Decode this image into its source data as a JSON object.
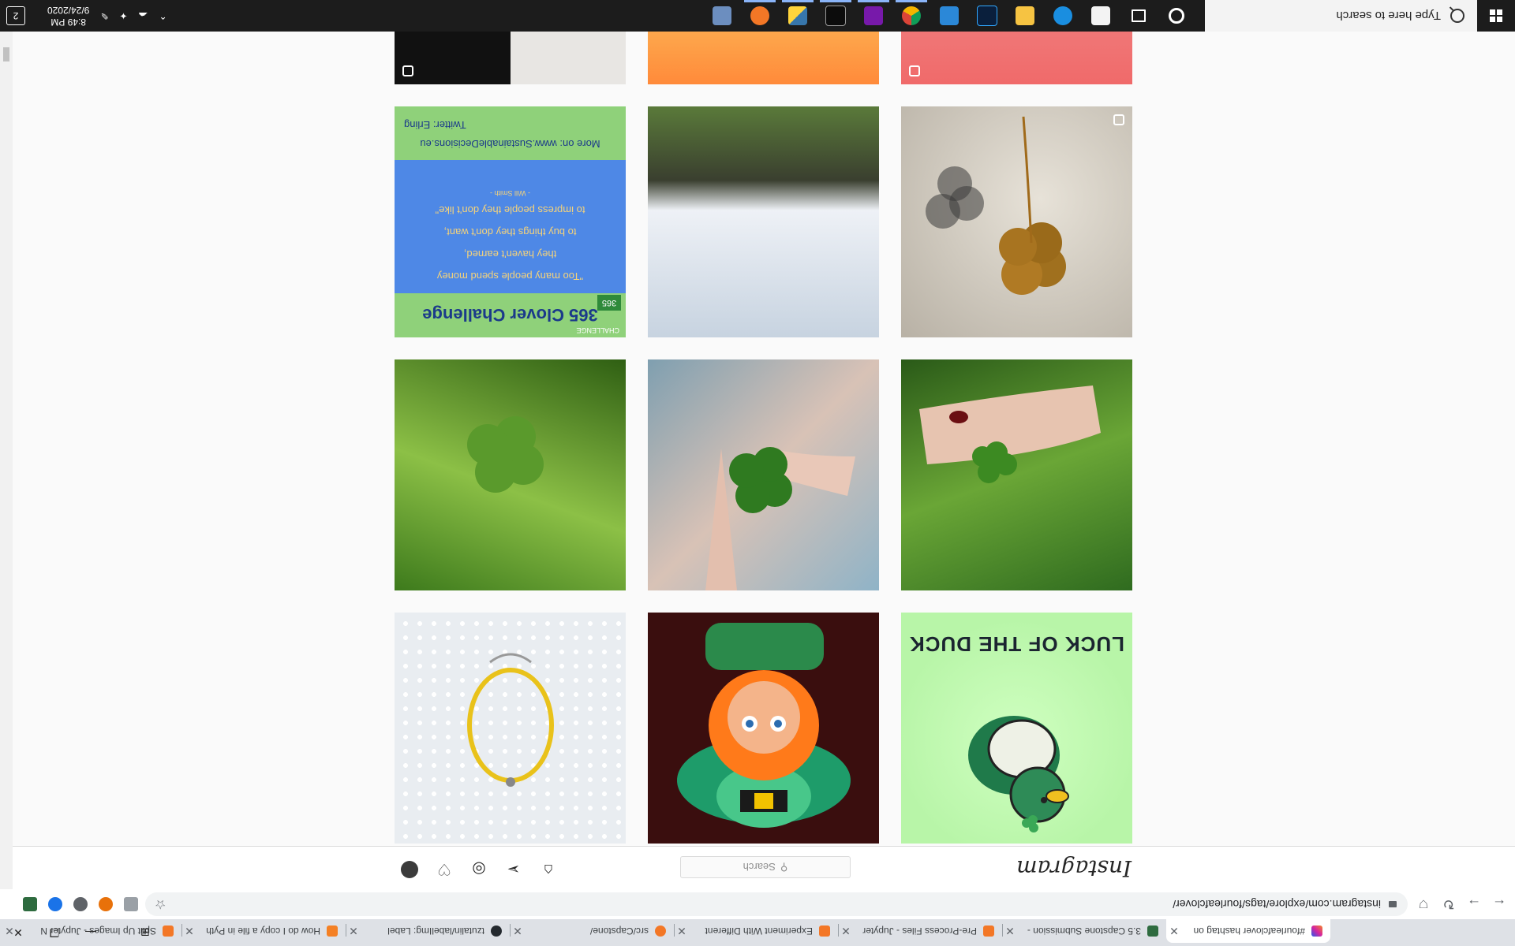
{
  "browser": {
    "tabs": [
      {
        "title": "#fourleafclover hashtag on",
        "color": "#d6249f"
      },
      {
        "title": "3.5 Capstone Submission -",
        "color": "#2e6b3f"
      },
      {
        "title": "Pre-Process Files - Jupyter",
        "color": "#f37726"
      },
      {
        "title": "Experiment With Different",
        "color": "#f37726"
      },
      {
        "title": "src/Capstone/",
        "color": "#f37726"
      },
      {
        "title": "tzutalin/labelImg: Label",
        "color": "#24292e"
      },
      {
        "title": "How do I copy a file in Pyth",
        "color": "#f48024"
      },
      {
        "title": "Split Up Images - Jupyter N",
        "color": "#f37726"
      }
    ],
    "url": "instagram.com/explore/tags/fourleafclover/"
  },
  "instagram": {
    "logo": "Instagram",
    "search_placeholder": "Search",
    "grid": [
      {
        "name": "post-duck",
        "caption": "LUCK OF THE DUCK"
      },
      {
        "name": "post-leprechaun",
        "caption": ""
      },
      {
        "name": "post-bracelet",
        "caption": ""
      },
      {
        "name": "post-hand-clover",
        "caption": ""
      },
      {
        "name": "post-clover-fingers",
        "caption": ""
      },
      {
        "name": "post-grass-clover",
        "caption": ""
      },
      {
        "name": "post-dried-clover",
        "caption": ""
      },
      {
        "name": "post-snow-field",
        "caption": ""
      },
      {
        "name": "post-365-challenge",
        "caption": "365 Clover Challenge"
      }
    ],
    "quote": {
      "challenge": "CHALLENGE",
      "badge": "365",
      "line1": "\"Too many people spend money",
      "line2": "they haven't earned,",
      "line3": "to buy things they don't want,",
      "line4": "to impress people they don't like\"",
      "author": "- Will Smith -",
      "footer1": "More on: www.SustainableDecisions.eu",
      "footer2": "Twitter: Erling"
    }
  },
  "taskbar": {
    "search_placeholder": "Type here to search",
    "time": "8:49 PM",
    "date": "9/24/2020",
    "notifications": "2"
  }
}
